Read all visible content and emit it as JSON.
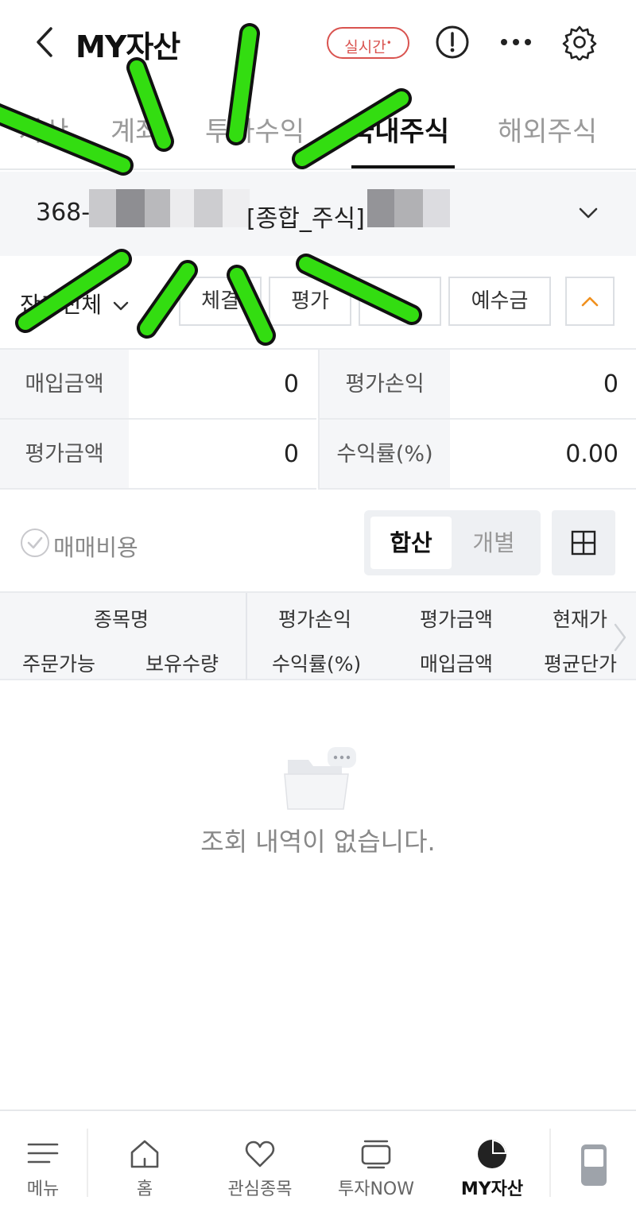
{
  "header": {
    "title": "MY자산",
    "realtime_label": "실시간",
    "realtime_dot": "•"
  },
  "tabs": [
    {
      "label": "자산"
    },
    {
      "label": "계좌"
    },
    {
      "label": "투자수익"
    },
    {
      "label": "국내주식"
    },
    {
      "label": "해외주식"
    }
  ],
  "account": {
    "number_prefix": "368-",
    "name": "[종합_주식]"
  },
  "filters": {
    "scope_label": "잔고전체",
    "buttons": [
      "체결",
      "평가",
      "",
      "예수금"
    ]
  },
  "summary": {
    "buy_amount_label": "매입금액",
    "buy_amount_value": "0",
    "pl_label": "평가손익",
    "pl_value": "0",
    "eval_amount_label": "평가금액",
    "eval_amount_value": "0",
    "return_label": "수익률(%)",
    "return_value": "0.00"
  },
  "controls": {
    "fee_label": "매매비용",
    "seg_combined": "합산",
    "seg_individual": "개별"
  },
  "table_header": {
    "row1": [
      "종목명",
      "평가손익",
      "평가금액",
      "현재가"
    ],
    "row2": [
      "주문가능",
      "보유수량",
      "수익률(%)",
      "매입금액",
      "평균단가"
    ]
  },
  "empty": {
    "message": "조회 내역이 없습니다."
  },
  "bottom_nav": [
    {
      "label": "메뉴"
    },
    {
      "label": "홈"
    },
    {
      "label": "관심종목"
    },
    {
      "label": "투자NOW"
    },
    {
      "label": "MY자산"
    }
  ],
  "colors": {
    "accent_red": "#d9534f",
    "accent_orange": "#f0901e",
    "scribble_green": "#33dd11"
  }
}
